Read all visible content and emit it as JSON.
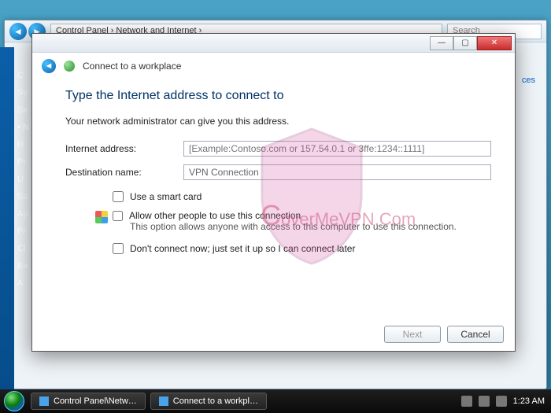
{
  "bg": {
    "breadcrumb": "Control Panel  ›  Network and Internet  ›",
    "search_placeholder": "Search",
    "link": "ces",
    "side": [
      "C",
      "Sy",
      "Se",
      "N",
      "H",
      "Pr",
      "U",
      "Sa",
      "Ap",
      "Pr",
      "Cl",
      "Ea",
      "A"
    ]
  },
  "dialog": {
    "title": "Connect to a workplace",
    "headline": "Type the Internet address to connect to",
    "admin_note": "Your network administrator can give you this address.",
    "internet_label": "Internet address:",
    "internet_placeholder": "[Example:Contoso.com or 157.54.0.1 or 3ffe:1234::1111]",
    "dest_label": "Destination name:",
    "dest_value": "VPN Connection",
    "chk_smartcard": "Use a smart card",
    "chk_allow": "Allow other people to use this connection",
    "allow_sub": "This option allows anyone with access to this computer to use this connection.",
    "chk_later": "Don't connect now; just set it up so I can connect later",
    "next": "Next",
    "cancel": "Cancel"
  },
  "watermark": {
    "text_pre": "C",
    "text_rest": "overMeVPN.Com"
  },
  "taskbar": {
    "items": [
      "Control Panel\\Netw…",
      "Connect to a workpl…"
    ],
    "time": "1:23 AM"
  }
}
